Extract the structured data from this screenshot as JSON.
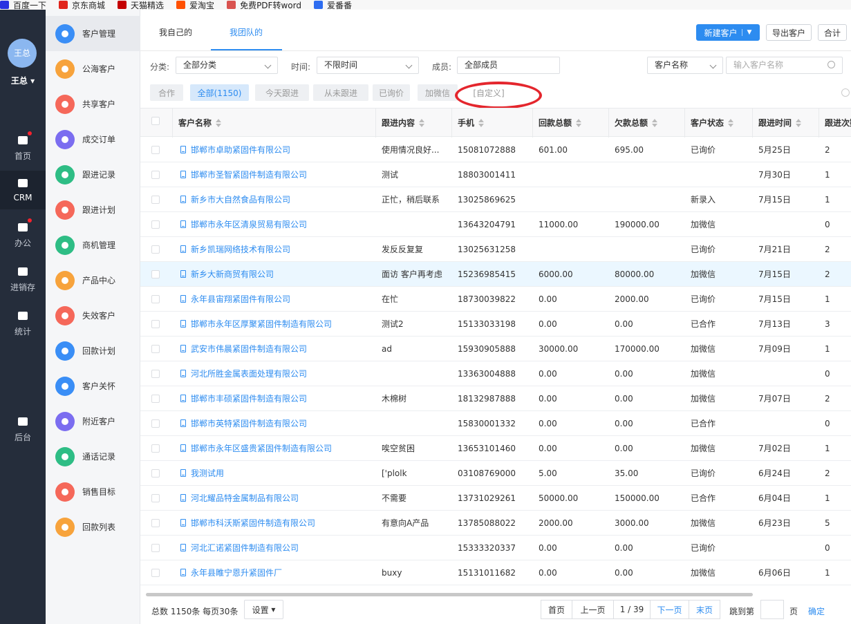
{
  "bookmarks": [
    {
      "label": "百度一下",
      "icon": "baidu-icon",
      "color": "#2932e1"
    },
    {
      "label": "京东商城",
      "icon": "jd-icon",
      "color": "#e1251b"
    },
    {
      "label": "天猫精选",
      "icon": "tmall-icon",
      "color": "#c40000"
    },
    {
      "label": "爱淘宝",
      "icon": "taobao-icon",
      "color": "#ff5000"
    },
    {
      "label": "免费PDF转word",
      "icon": "pdf-icon",
      "color": "#d9534f"
    },
    {
      "label": "爱番番",
      "icon": "paw-icon",
      "color": "#2d6cf0"
    }
  ],
  "user": {
    "avatar_text": "王总",
    "name": "王总"
  },
  "dark_nav": [
    {
      "label": "首页",
      "icon": "home-icon",
      "badge": true
    },
    {
      "label": "CRM",
      "icon": "crm-icon",
      "active": true
    },
    {
      "label": "办公",
      "icon": "briefcase-icon",
      "badge": true
    },
    {
      "label": "进销存",
      "icon": "warehouse-icon"
    },
    {
      "label": "统计",
      "icon": "pie-chart-icon"
    },
    {
      "label": "后台",
      "icon": "grid-icon"
    }
  ],
  "menu": [
    {
      "label": "客户管理",
      "icon": "customers-icon",
      "color": "#3a8ef6",
      "active": true
    },
    {
      "label": "公海客户",
      "icon": "public-customer-icon",
      "color": "#f7a33c"
    },
    {
      "label": "共享客户",
      "icon": "shared-customer-icon",
      "color": "#f5685a"
    },
    {
      "label": "成交订单",
      "icon": "order-icon",
      "color": "#7b6df0"
    },
    {
      "label": "跟进记录",
      "icon": "record-icon",
      "color": "#2ebd85"
    },
    {
      "label": "跟进计划",
      "icon": "plan-icon",
      "color": "#f5685a"
    },
    {
      "label": "商机管理",
      "icon": "bulb-icon",
      "color": "#2ebd85"
    },
    {
      "label": "产品中心",
      "icon": "box-icon",
      "color": "#f7a33c"
    },
    {
      "label": "失效客户",
      "icon": "warning-icon",
      "color": "#f5685a"
    },
    {
      "label": "回款计划",
      "icon": "payment-plan-icon",
      "color": "#3a8ef6"
    },
    {
      "label": "客户关怀",
      "icon": "care-icon",
      "color": "#3a8ef6"
    },
    {
      "label": "附近客户",
      "icon": "location-icon",
      "color": "#7b6df0"
    },
    {
      "label": "通话记录",
      "icon": "phone-icon",
      "color": "#2ebd85"
    },
    {
      "label": "销售目标",
      "icon": "target-icon",
      "color": "#f5685a"
    },
    {
      "label": "回款列表",
      "icon": "payment-list-icon",
      "color": "#f7a33c"
    }
  ],
  "tabs": {
    "mine": "我自己的",
    "team": "我团队的"
  },
  "actions": {
    "new_customer": "新建客户",
    "export": "导出客户",
    "total": "合计"
  },
  "filters": {
    "category_label": "分类:",
    "category_value": "全部分类",
    "time_label": "时间:",
    "time_value": "不限时间",
    "member_label": "成员:",
    "member_value": "全部成员",
    "search_field": "客户名称",
    "search_placeholder": "输入客户名称"
  },
  "quick_filters": [
    "合作",
    "全部(1150)",
    "今天跟进",
    "从未跟进",
    "已询价",
    "加微信",
    "[自定义]"
  ],
  "columns": [
    "客户名称",
    "跟进内容",
    "手机",
    "回款总额",
    "欠款总额",
    "客户状态",
    "跟进时间",
    "跟进次数"
  ],
  "rows": [
    {
      "name": "邯郸市卓助紧固件有限公司",
      "content": "使用情况良好...",
      "phone": "15081072888",
      "paid": "601.00",
      "owed": "695.00",
      "status": "已询价",
      "time": "5月25日",
      "count": "2"
    },
    {
      "name": "邯郸市圣智紧固件制造有限公司",
      "content": "测试",
      "phone": "18803001411",
      "paid": "",
      "owed": "",
      "status": "",
      "time": "7月30日",
      "count": "1"
    },
    {
      "name": "新乡市大自然食品有限公司",
      "content": "正忙，稍后联系",
      "phone": "13025869625",
      "paid": "",
      "owed": "",
      "status": "新录入",
      "time": "7月15日",
      "count": "1"
    },
    {
      "name": "邯郸市永年区清泉贸易有限公司",
      "content": "",
      "phone": "13643204791",
      "paid": "11000.00",
      "owed": "190000.00",
      "status": "加微信",
      "time": "",
      "count": "0"
    },
    {
      "name": "新乡凯瑞网络技术有限公司",
      "content": "发反反复复",
      "phone": "13025631258",
      "paid": "",
      "owed": "",
      "status": "已询价",
      "time": "7月21日",
      "count": "2"
    },
    {
      "name": "新乡大新商贸有限公司",
      "content": "面访 客户再考虑",
      "phone": "15236985415",
      "paid": "6000.00",
      "owed": "80000.00",
      "status": "加微信",
      "time": "7月15日",
      "count": "2",
      "highlight": true
    },
    {
      "name": "永年县宙翔紧固件有限公司",
      "content": "在忙",
      "phone": "18730039822",
      "paid": "0.00",
      "owed": "2000.00",
      "status": "已询价",
      "time": "7月15日",
      "count": "1"
    },
    {
      "name": "邯郸市永年区厚聚紧固件制造有限公司",
      "content": "测试2",
      "phone": "15133033198",
      "paid": "0.00",
      "owed": "0.00",
      "status": "已合作",
      "time": "7月13日",
      "count": "3"
    },
    {
      "name": "武安市伟晨紧固件制造有限公司",
      "content": "ad",
      "phone": "15930905888",
      "paid": "30000.00",
      "owed": "170000.00",
      "status": "加微信",
      "time": "7月09日",
      "count": "1"
    },
    {
      "name": "河北所胜金属表面处理有限公司",
      "content": "",
      "phone": "13363004888",
      "paid": "0.00",
      "owed": "0.00",
      "status": "加微信",
      "time": "",
      "count": "0"
    },
    {
      "name": "邯郸市丰硕紧固件制造有限公司",
      "content": "木棉树",
      "phone": "18132987888",
      "paid": "0.00",
      "owed": "0.00",
      "status": "加微信",
      "time": "7月07日",
      "count": "2"
    },
    {
      "name": "邯郸市英特紧固件制造有限公司",
      "content": "",
      "phone": "15830001332",
      "paid": "0.00",
      "owed": "0.00",
      "status": "已合作",
      "time": "",
      "count": "0"
    },
    {
      "name": "邯郸市永年区盛贵紧固件制造有限公司",
      "content": "唉空贫困",
      "phone": "13653101460",
      "paid": "0.00",
      "owed": "0.00",
      "status": "加微信",
      "time": "7月02日",
      "count": "1"
    },
    {
      "name": "我测试用",
      "content": "['plolk",
      "phone": "03108769000",
      "paid": "5.00",
      "owed": "35.00",
      "status": "已询价",
      "time": "6月24日",
      "count": "2"
    },
    {
      "name": "河北耀品特金属制品有限公司",
      "content": "不需要",
      "phone": "13731029261",
      "paid": "50000.00",
      "owed": "150000.00",
      "status": "已合作",
      "time": "6月04日",
      "count": "1"
    },
    {
      "name": "邯郸市科沃斯紧固件制造有限公司",
      "content": "有意向A产品",
      "phone": "13785088022",
      "paid": "2000.00",
      "owed": "3000.00",
      "status": "加微信",
      "time": "6月23日",
      "count": "5"
    },
    {
      "name": "河北汇诺紧固件制造有限公司",
      "content": "",
      "phone": "15333320337",
      "paid": "0.00",
      "owed": "0.00",
      "status": "已询价",
      "time": "",
      "count": "0"
    },
    {
      "name": "永年县睢宁恩升紧固件厂",
      "content": "buxy",
      "phone": "15131011682",
      "paid": "0.00",
      "owed": "0.00",
      "status": "加微信",
      "time": "6月06日",
      "count": "1"
    }
  ],
  "footer": {
    "summary": "总数 1150条 每页30条",
    "settings": "设置",
    "first": "首页",
    "prev": "上一页",
    "page": "1 / 39",
    "next": "下一页",
    "last": "末页",
    "jump_label": "跳到第",
    "page_unit": "页",
    "confirm": "确定"
  },
  "colors": {
    "accent": "#2d8cf0",
    "sidebar": "#252d3b",
    "highlight_ring": "#e4262d"
  }
}
